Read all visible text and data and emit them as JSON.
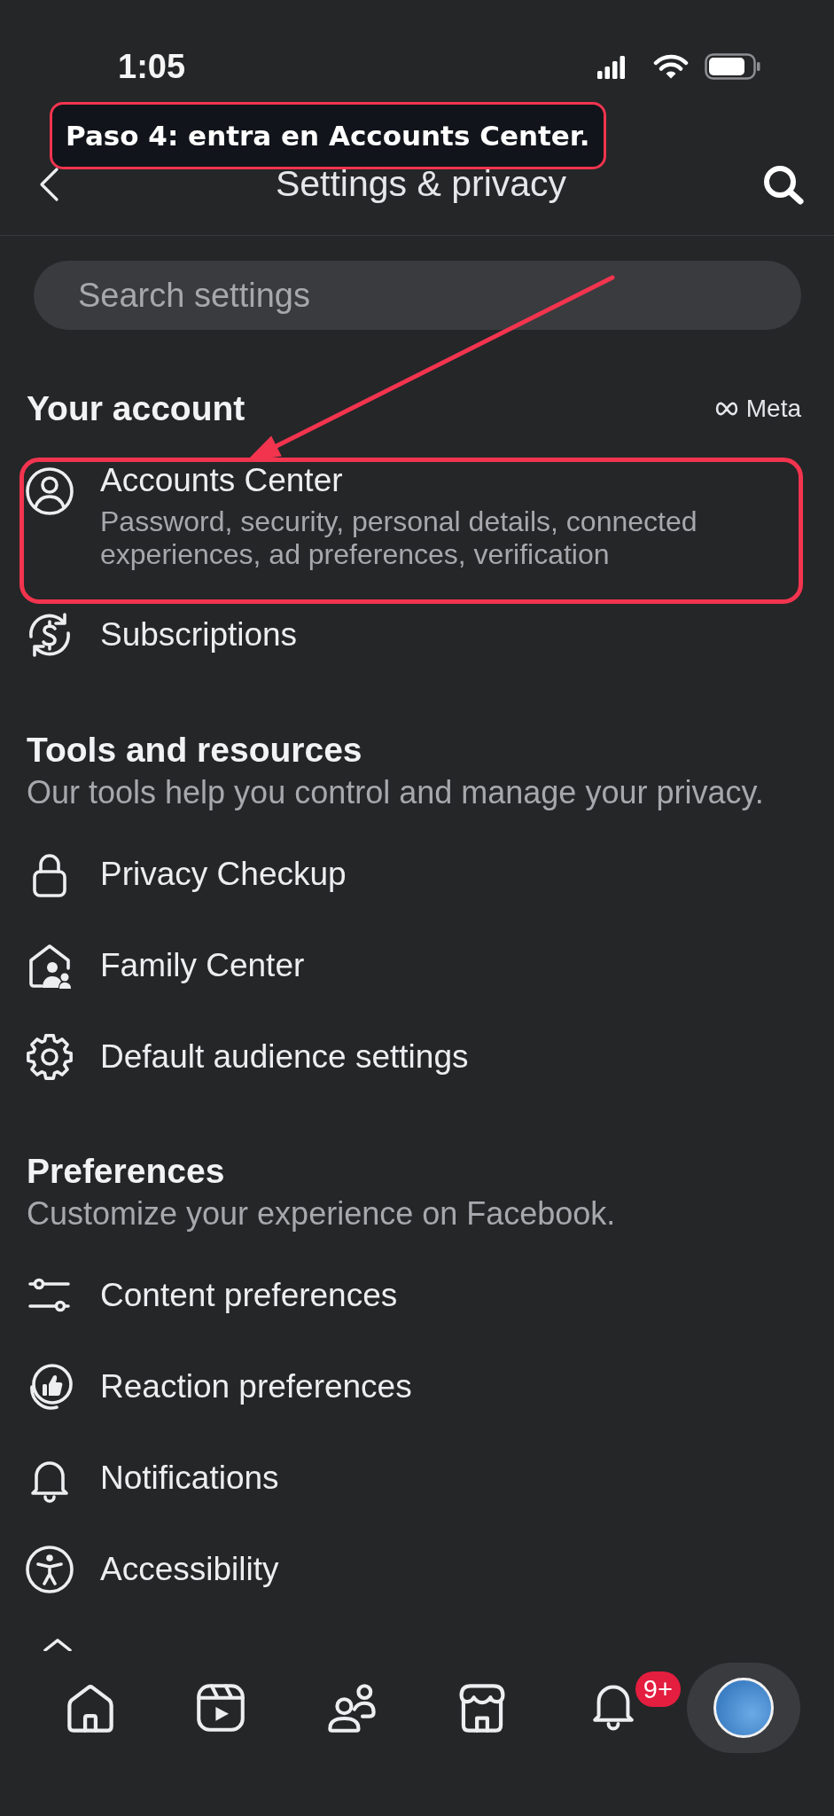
{
  "status_bar": {
    "time": "1:05"
  },
  "annotation": {
    "callout": "Paso 4: entra en Accounts Center."
  },
  "header": {
    "title": "Settings & privacy"
  },
  "search": {
    "placeholder": "Search settings"
  },
  "sections": [
    {
      "title": "Your account",
      "brand": "Meta",
      "items": [
        {
          "label": "Accounts Center",
          "description": "Password, security, personal details, connected experiences, ad preferences, verification",
          "highlighted": true
        },
        {
          "label": "Subscriptions",
          "highlighted": false
        }
      ]
    },
    {
      "title": "Tools and resources",
      "subtitle": "Our tools help you control and manage your privacy.",
      "items": [
        {
          "label": "Privacy Checkup",
          "highlighted": false
        },
        {
          "label": "Family Center",
          "highlighted": false
        },
        {
          "label": "Default audience settings",
          "highlighted": false
        }
      ]
    },
    {
      "title": "Preferences",
      "subtitle": "Customize your experience on Facebook.",
      "items": [
        {
          "label": "Content preferences",
          "highlighted": false
        },
        {
          "label": "Reaction preferences",
          "highlighted": false
        },
        {
          "label": "Notifications",
          "highlighted": false
        },
        {
          "label": "Accessibility",
          "highlighted": false
        }
      ]
    }
  ],
  "bottom_nav": [
    {
      "selected": false
    },
    {
      "selected": false
    },
    {
      "selected": false
    },
    {
      "selected": false
    },
    {
      "selected": false,
      "badge": "9+"
    },
    {
      "selected": true
    }
  ]
}
